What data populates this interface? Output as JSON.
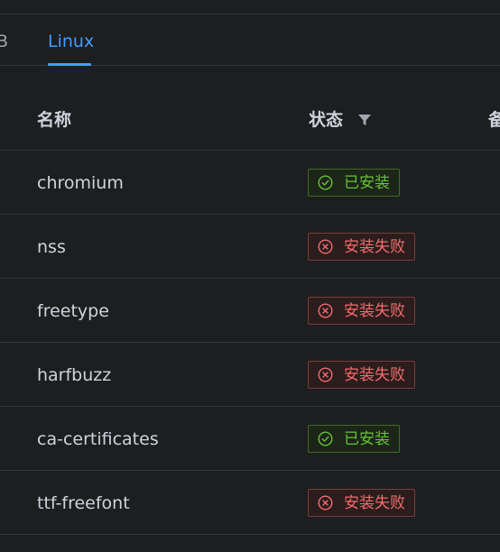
{
  "tabs": {
    "partial_label": "B",
    "active_label": "Linux"
  },
  "table": {
    "headers": {
      "name": "名称",
      "status": "状态",
      "partial": "备"
    },
    "rows": [
      {
        "name": "chromium",
        "status": "已安装",
        "state": "success"
      },
      {
        "name": "nss",
        "status": "安装失败",
        "state": "danger"
      },
      {
        "name": "freetype",
        "status": "安装失败",
        "state": "danger"
      },
      {
        "name": "harfbuzz",
        "status": "安装失败",
        "state": "danger"
      },
      {
        "name": "ca-certificates",
        "status": "已安装",
        "state": "success"
      },
      {
        "name": "ttf-freefont",
        "status": "安装失败",
        "state": "danger"
      }
    ]
  },
  "colors": {
    "accent": "#409eff",
    "success": "#67c23a",
    "danger": "#f56c6c",
    "background": "#1d1e1f"
  },
  "icons": {
    "success": "check-circle-icon",
    "danger": "close-circle-icon",
    "filter": "filter-icon"
  }
}
